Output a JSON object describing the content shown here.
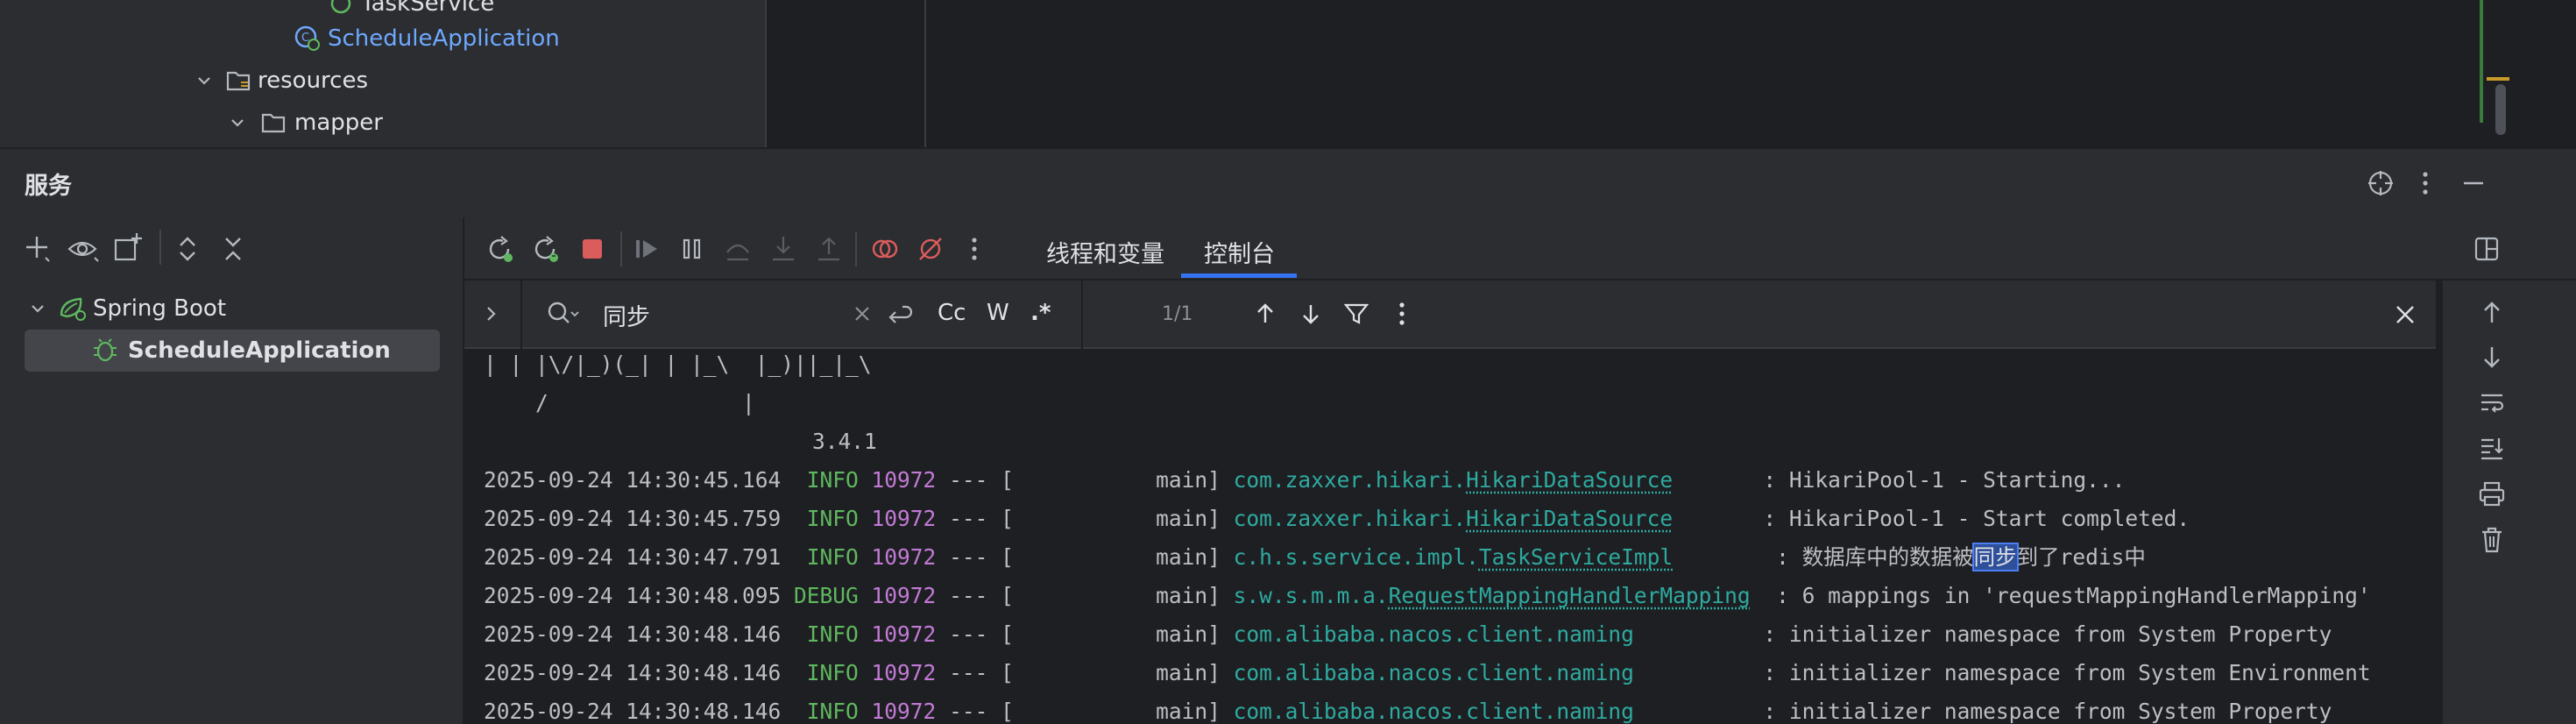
{
  "project_tree": {
    "partial_item": "TaskService",
    "schedule_app": "ScheduleApplication",
    "resources": "resources",
    "mapper": "mapper"
  },
  "services_panel": {
    "title": "服务",
    "tree": {
      "group": "Spring Boot",
      "app": "ScheduleApplication"
    }
  },
  "debug_tabs": {
    "threads_label": "线程和变量",
    "console_label": "控制台"
  },
  "search": {
    "query": "同步",
    "match_case_label": "Cc",
    "words_label": "W",
    "regex_label": ".*",
    "match_count": "1/1"
  },
  "console": {
    "banner_line_1": "| | |\\/|_)(_| | |_\\  |_)||_|_\\",
    "banner_line_2": "    /               |",
    "version": "3.4.1",
    "lines": [
      {
        "ts": "2025-09-24 14:30:45.164",
        "level": " INFO",
        "pid": "10972",
        "sep": " --- [",
        "thread": "           main]",
        "logger_pre": "com.zaxxer.hikari.",
        "logger_link": "HikariDataSource",
        "logger_pad": "      ",
        "msg": ": HikariPool-1 - Starting..."
      },
      {
        "ts": "2025-09-24 14:30:45.759",
        "level": " INFO",
        "pid": "10972",
        "sep": " --- [",
        "thread": "           main]",
        "logger_pre": "com.zaxxer.hikari.",
        "logger_link": "HikariDataSource",
        "logger_pad": "      ",
        "msg": ": HikariPool-1 - Start completed."
      },
      {
        "ts": "2025-09-24 14:30:47.791",
        "level": " INFO",
        "pid": "10972",
        "sep": " --- [",
        "thread": "           main]",
        "logger_pre": "c.h.s.service.impl.",
        "logger_link": "TaskServiceImpl",
        "logger_pad": "       ",
        "msg_pre": ": 数据库中的数据被",
        "msg_hl": "同步",
        "msg_post": "到了redis中"
      },
      {
        "ts": "2025-09-24 14:30:48.095",
        "level": "DEBUG",
        "pid": "10972",
        "sep": " --- [",
        "thread": "           main]",
        "logger_pre": "s.w.s.m.m.a.",
        "logger_link": "RequestMappingHandlerMapping",
        "logger_pad": " ",
        "msg": ": 6 mappings in 'requestMappingHandlerMapping'"
      },
      {
        "ts": "2025-09-24 14:30:48.146",
        "level": " INFO",
        "pid": "10972",
        "sep": " --- [",
        "thread": "           main]",
        "logger_pre": "com.alibaba.nacos.client.naming",
        "logger_link": "",
        "logger_pad": "         ",
        "msg": ": initializer namespace from System Property"
      },
      {
        "ts": "2025-09-24 14:30:48.146",
        "level": " INFO",
        "pid": "10972",
        "sep": " --- [",
        "thread": "           main]",
        "logger_pre": "com.alibaba.nacos.client.naming",
        "logger_link": "",
        "logger_pad": "         ",
        "msg": ": initializer namespace from System Environment"
      },
      {
        "ts": "2025-09-24 14:30:48.146",
        "level": " INFO",
        "pid": "10972",
        "sep": " --- [",
        "thread": "           main]",
        "logger_pre": "com.alibaba.nacos.client.naming",
        "logger_link": "",
        "logger_pad": "         ",
        "msg": ": initializer namespace from System Property"
      }
    ]
  },
  "colors": {
    "accent": "#3574f0",
    "info": "#5fb85f",
    "pid": "#c27ad6",
    "logger": "#2eaaa0",
    "link": "#6fa8ff"
  }
}
